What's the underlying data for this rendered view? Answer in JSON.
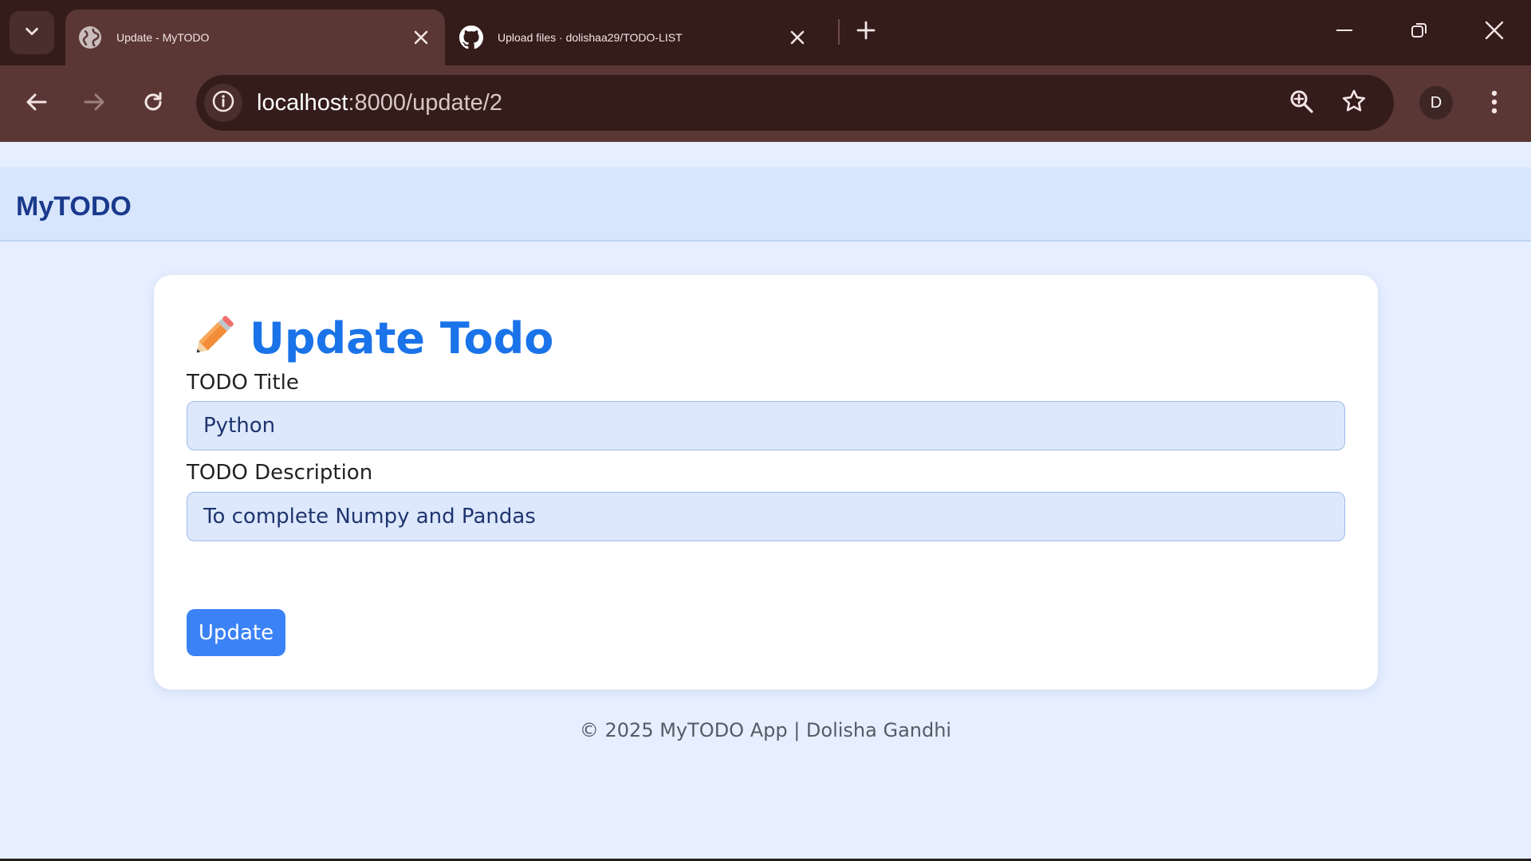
{
  "browser": {
    "tabs": [
      {
        "title": "Update - MyTODO",
        "favicon": "globe-icon",
        "active": true
      },
      {
        "title": "Upload files · dolishaa29/TODO-LIST",
        "favicon": "github-icon",
        "active": false
      }
    ],
    "address_bar": {
      "host": "localhost",
      "path": ":8000/update/2"
    },
    "profile_initial": "D",
    "colors": {
      "tabstrip": "#341c1b",
      "toolbar": "#5a3735"
    }
  },
  "app": {
    "brand": "MyTODO"
  },
  "form": {
    "title": "Update Todo",
    "title_icon": "pencil-icon",
    "title_field": {
      "label": "TODO Title",
      "value": "Python"
    },
    "description_field": {
      "label": "TODO Description",
      "value": "To complete Numpy and Pandas"
    },
    "submit_label": "Update",
    "accent_color": "#1a73e8",
    "button_color": "#3b82f6"
  },
  "footer": {
    "text": "© 2025 MyTODO App | Dolisha Gandhi"
  }
}
